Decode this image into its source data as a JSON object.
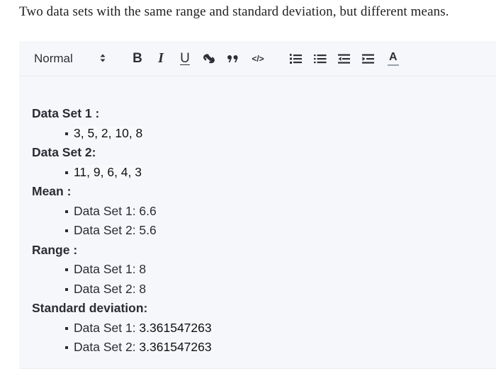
{
  "intro_text": "Two data sets with the same range and standard deviation, but different means.",
  "toolbar": {
    "format_select": "Normal",
    "buttons": [
      {
        "name": "bold-button",
        "icon": "bold-icon",
        "glyph": "B"
      },
      {
        "name": "italic-button",
        "icon": "italic-icon",
        "glyph": "I"
      },
      {
        "name": "underline-button",
        "icon": "underline-icon",
        "glyph": "U"
      },
      {
        "name": "link-button",
        "icon": "link-icon"
      },
      {
        "name": "blockquote-button",
        "icon": "quote-icon",
        "glyph": "”"
      },
      {
        "name": "code-button",
        "icon": "code-icon",
        "glyph": "</>"
      },
      {
        "name": "ordered-list-button",
        "icon": "ordered-list-icon"
      },
      {
        "name": "bullet-list-button",
        "icon": "bullet-list-icon"
      },
      {
        "name": "outdent-button",
        "icon": "outdent-icon"
      },
      {
        "name": "indent-button",
        "icon": "indent-icon"
      },
      {
        "name": "text-color-button",
        "icon": "text-color-icon",
        "glyph": "A"
      }
    ]
  },
  "content": {
    "sections": [
      {
        "heading": "Data Set 1 :",
        "items": [
          {
            "text": "3, 5, 2, 10, 8"
          }
        ]
      },
      {
        "heading": "Data Set 2:",
        "items": [
          {
            "text": "11, 9, 6, 4, 3"
          }
        ]
      },
      {
        "heading": "Mean :",
        "items": [
          {
            "label": "Data Set 1: ",
            "value": "6.6"
          },
          {
            "label": "Data Set 2: ",
            "value": "5.6"
          }
        ]
      },
      {
        "heading": "Range :",
        "items": [
          {
            "label": "Data Set 1: ",
            "value": "8"
          },
          {
            "label": "Data Set 2: ",
            "value": "8"
          }
        ]
      },
      {
        "heading": "Standard deviation:",
        "items": [
          {
            "label": "Data Set 1: ",
            "value": "3.361547263"
          },
          {
            "label": "Data Set 2: ",
            "value": "3.361547263"
          }
        ]
      }
    ]
  }
}
